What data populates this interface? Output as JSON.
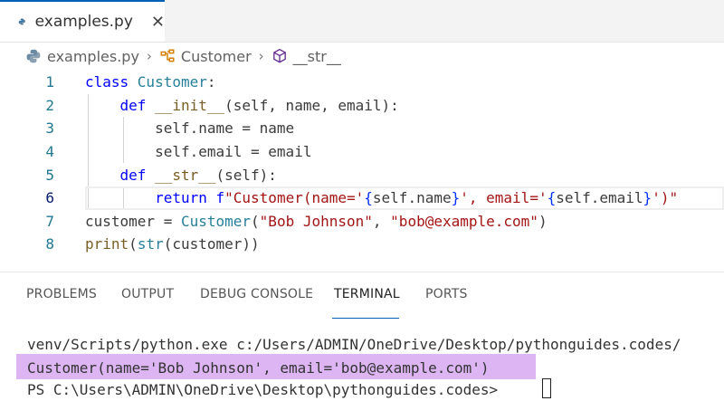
{
  "tab": {
    "label": "examples.py",
    "close": "✕"
  },
  "breadcrumb": {
    "file": "examples.py",
    "class": "Customer",
    "method": "__str__"
  },
  "editor": {
    "line_numbers": [
      "1",
      "2",
      "3",
      "4",
      "5",
      "6",
      "7",
      "8"
    ],
    "lines": [
      [
        {
          "t": "class ",
          "c": "kw"
        },
        {
          "t": "Customer",
          "c": "cls"
        },
        {
          "t": ":",
          "c": ""
        }
      ],
      [
        {
          "t": "    ",
          "c": ""
        },
        {
          "t": "def ",
          "c": "kw"
        },
        {
          "t": "__init__",
          "c": "fn"
        },
        {
          "t": "(self, name, email):",
          "c": ""
        }
      ],
      [
        {
          "t": "        self.name = name",
          "c": ""
        }
      ],
      [
        {
          "t": "        self.email = email",
          "c": ""
        }
      ],
      [
        {
          "t": "    ",
          "c": ""
        },
        {
          "t": "def ",
          "c": "kw"
        },
        {
          "t": "__str__",
          "c": "fn"
        },
        {
          "t": "(self):",
          "c": ""
        }
      ],
      [
        {
          "t": "        ",
          "c": ""
        },
        {
          "t": "return ",
          "c": "kw"
        },
        {
          "t": "f",
          "c": "kw"
        },
        {
          "t": "\"Customer(name='",
          "c": "str"
        },
        {
          "t": "{",
          "c": "br"
        },
        {
          "t": "self.name",
          "c": ""
        },
        {
          "t": "}",
          "c": "br"
        },
        {
          "t": "', email='",
          "c": "str"
        },
        {
          "t": "{",
          "c": "br"
        },
        {
          "t": "self.email",
          "c": ""
        },
        {
          "t": "}",
          "c": "br"
        },
        {
          "t": "')\"",
          "c": "str"
        }
      ],
      [
        {
          "t": "customer = ",
          "c": ""
        },
        {
          "t": "Customer",
          "c": "cls"
        },
        {
          "t": "(",
          "c": ""
        },
        {
          "t": "\"Bob Johnson\"",
          "c": "str"
        },
        {
          "t": ", ",
          "c": ""
        },
        {
          "t": "\"bob@example.com\"",
          "c": "str"
        },
        {
          "t": ")",
          "c": ""
        }
      ],
      [
        {
          "t": "print",
          "c": "fn"
        },
        {
          "t": "(",
          "c": ""
        },
        {
          "t": "str",
          "c": "cls"
        },
        {
          "t": "(customer))",
          "c": ""
        }
      ]
    ]
  },
  "panel": {
    "tabs": [
      "PROBLEMS",
      "OUTPUT",
      "DEBUG CONSOLE",
      "TERMINAL",
      "PORTS"
    ],
    "active_tab": "TERMINAL"
  },
  "terminal": {
    "lines": [
      "venv/Scripts/python.exe c:/Users/ADMIN/OneDrive/Desktop/pythonguides.codes/",
      "Customer(name='Bob Johnson', email='bob@example.com')",
      "PS C:\\Users\\ADMIN\\OneDrive\\Desktop\\pythonguides.codes> "
    ]
  },
  "colors": {
    "accent": "#005fb8",
    "keyword": "#0000ff",
    "class": "#267f99",
    "function": "#795e26",
    "string": "#a31515",
    "highlight": "#d6a8f0"
  }
}
